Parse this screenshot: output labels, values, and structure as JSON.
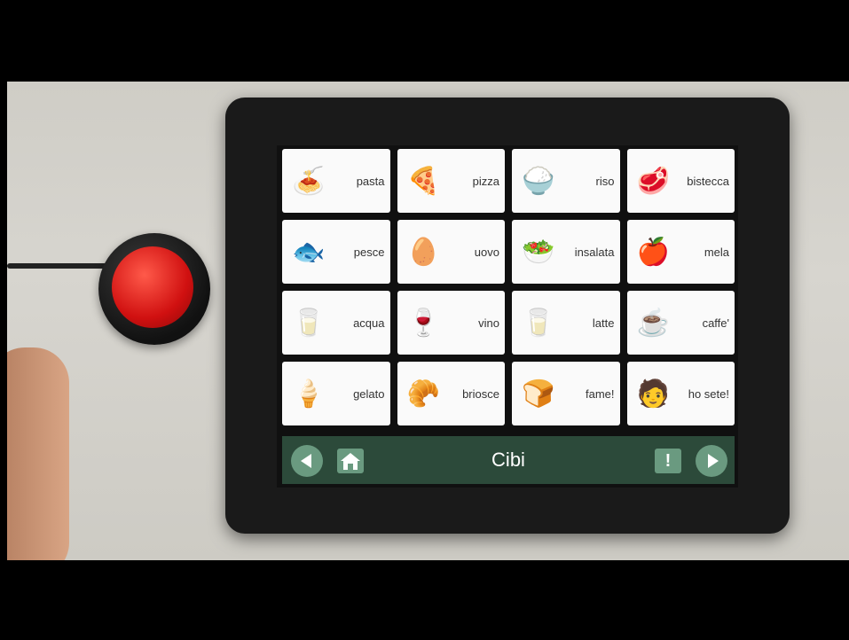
{
  "board": {
    "title": "Cibi",
    "items": [
      {
        "label": "pasta",
        "icon": "pasta-icon",
        "glyph": "🍝"
      },
      {
        "label": "pizza",
        "icon": "pizza-icon",
        "glyph": "🍕"
      },
      {
        "label": "riso",
        "icon": "rice-icon",
        "glyph": "🍚"
      },
      {
        "label": "bistecca",
        "icon": "steak-icon",
        "glyph": "🥩"
      },
      {
        "label": "pesce",
        "icon": "fish-icon",
        "glyph": "🐟"
      },
      {
        "label": "uovo",
        "icon": "egg-icon",
        "glyph": "🥚"
      },
      {
        "label": "insalata",
        "icon": "salad-icon",
        "glyph": "🥗"
      },
      {
        "label": "mela",
        "icon": "apple-icon",
        "glyph": "🍎"
      },
      {
        "label": "acqua",
        "icon": "water-glass-icon",
        "glyph": "🥛"
      },
      {
        "label": "vino",
        "icon": "wine-icon",
        "glyph": "🍷"
      },
      {
        "label": "latte",
        "icon": "milk-icon",
        "glyph": "🥛"
      },
      {
        "label": "caffe'",
        "icon": "coffee-icon",
        "glyph": "☕"
      },
      {
        "label": "gelato",
        "icon": "ice-cream-icon",
        "glyph": "🍦"
      },
      {
        "label": "briosce",
        "icon": "croissant-icon",
        "glyph": "🥐"
      },
      {
        "label": "fame!",
        "icon": "hungry-icon",
        "glyph": "🍞"
      },
      {
        "label": "ho sete!",
        "icon": "thirsty-person-icon",
        "glyph": "🧑"
      }
    ]
  },
  "toolbar": {
    "back_icon": "arrow-left-icon",
    "home_icon": "home-icon",
    "alert_icon": "exclamation-icon",
    "alert_glyph": "!",
    "forward_icon": "arrow-right-icon"
  },
  "colors": {
    "bar": "#2c4a3a",
    "button": "#6a9a80",
    "switch": "#d01010"
  }
}
